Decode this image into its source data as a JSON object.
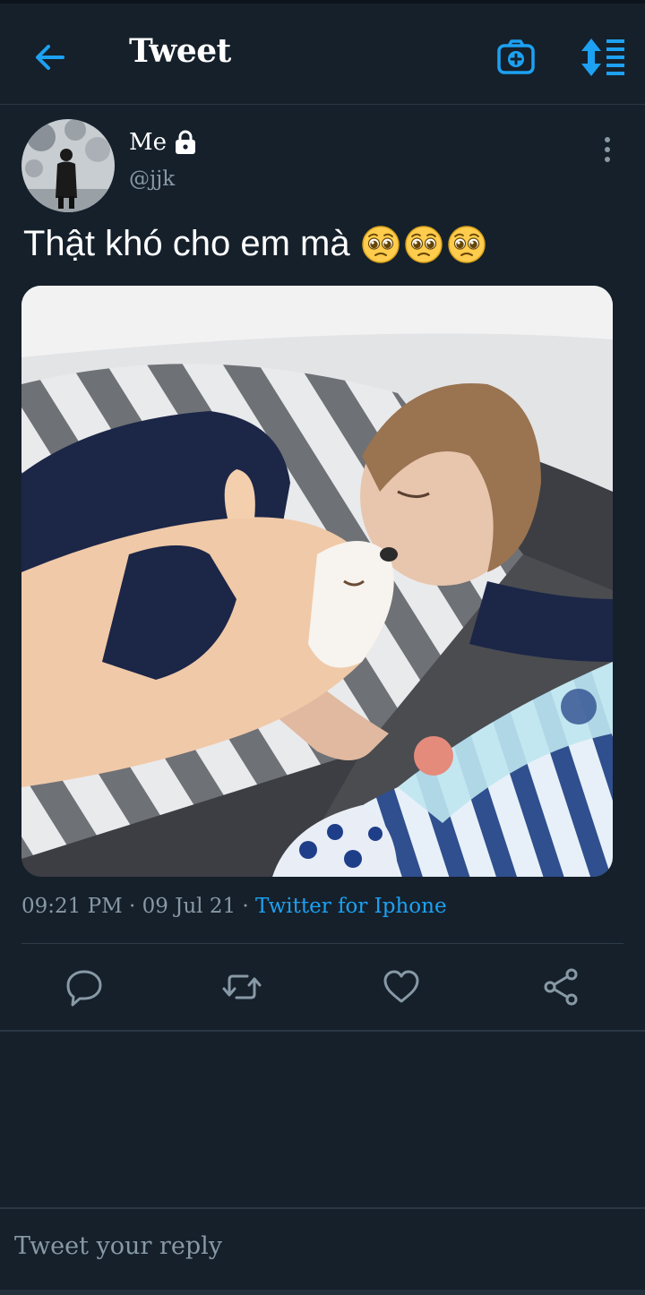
{
  "header": {
    "title": "Tweet",
    "back_icon": "arrow-left-icon",
    "camera_icon": "camera-plus-icon",
    "sort_icon": "sort-list-icon",
    "accent_color": "#1da1f2"
  },
  "tweet": {
    "author_name": "Me",
    "author_handle": "@jjk",
    "locked_icon": "lock-icon",
    "more_icon": "more-vertical-icon",
    "text": "Thật khó cho em mà",
    "emoji": [
      "🥺",
      "🥺",
      "🥺"
    ],
    "time": "09:21 PM",
    "date": "09 Jul 21",
    "separator": "·",
    "source": "Twitter for Iphone"
  },
  "actions": [
    {
      "icon": "reply-icon"
    },
    {
      "icon": "retweet-icon"
    },
    {
      "icon": "like-heart-icon"
    },
    {
      "icon": "share-icon"
    }
  ],
  "reply_box": {
    "placeholder": "Tweet your reply"
  },
  "colors": {
    "background": "#15202b",
    "muted_text": "#8899a6",
    "link": "#1da1f2"
  }
}
